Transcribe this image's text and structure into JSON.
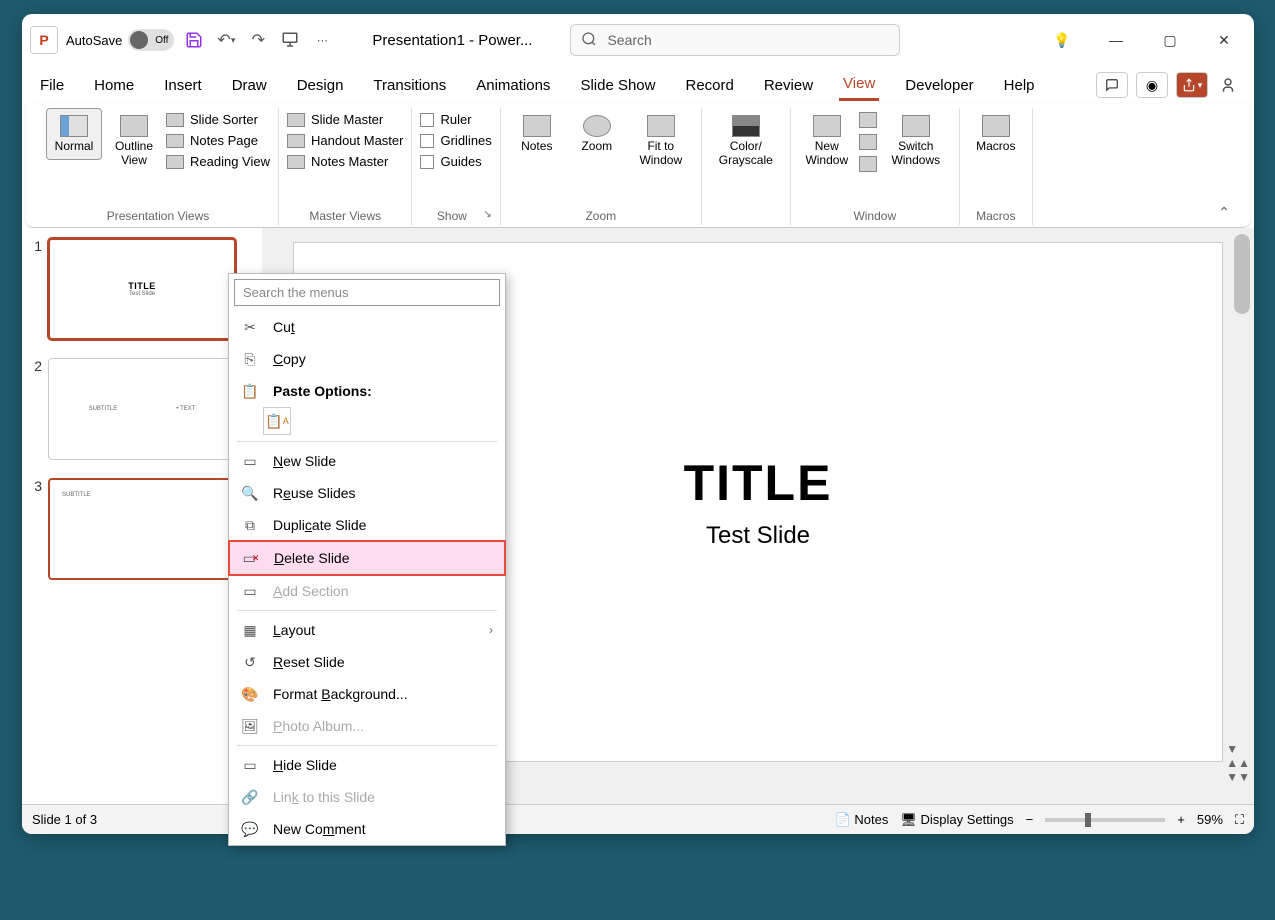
{
  "titlebar": {
    "app_letter": "P",
    "autosave_label": "AutoSave",
    "autosave_state": "Off",
    "document_title": "Presentation1  -  Power...",
    "search_placeholder": "Search"
  },
  "tabs": [
    "File",
    "Home",
    "Insert",
    "Draw",
    "Design",
    "Transitions",
    "Animations",
    "Slide Show",
    "Record",
    "Review",
    "View",
    "Developer",
    "Help"
  ],
  "active_tab": "View",
  "ribbon": {
    "groups": {
      "presentation_views": {
        "label": "Presentation Views",
        "normal": "Normal",
        "outline": "Outline View",
        "slide_sorter": "Slide Sorter",
        "notes_page": "Notes Page",
        "reading_view": "Reading View"
      },
      "master_views": {
        "label": "Master Views",
        "slide_master": "Slide Master",
        "handout_master": "Handout Master",
        "notes_master": "Notes Master"
      },
      "show": {
        "label": "Show",
        "ruler": "Ruler",
        "gridlines": "Gridlines",
        "guides": "Guides"
      },
      "notes_zoom": {
        "notes": "Notes",
        "zoom": "Zoom",
        "fit": "Fit to Window",
        "label": "Zoom"
      },
      "color": {
        "color": "Color/ Grayscale"
      },
      "window": {
        "label": "Window",
        "new_window": "New Window",
        "switch": "Switch Windows"
      },
      "macros": {
        "label": "Macros",
        "macros": "Macros"
      }
    }
  },
  "thumbnails": [
    {
      "num": "1",
      "title": "TITLE",
      "sub": "Test Slide",
      "selected": true
    },
    {
      "num": "2",
      "left": "SUBTITLE",
      "right": "• TEXT"
    },
    {
      "num": "3",
      "left": "SUBTITLE",
      "selected2": true
    }
  ],
  "slide": {
    "title": "TITLE",
    "sub": "Test Slide"
  },
  "context_menu": {
    "search_placeholder": "Search the menus",
    "cut": "Cut",
    "copy": "Copy",
    "paste_options": "Paste Options:",
    "new_slide": "New Slide",
    "reuse": "Reuse Slides",
    "duplicate": "Duplicate Slide",
    "delete": "Delete Slide",
    "add_section": "Add Section",
    "layout": "Layout",
    "reset": "Reset Slide",
    "format_bg": "Format Background...",
    "photo_album": "Photo Album...",
    "hide": "Hide Slide",
    "link": "Link to this Slide",
    "new_comment": "New Comment"
  },
  "statusbar": {
    "slide_info": "Slide 1 of 3",
    "notes": "Notes",
    "display": "Display Settings",
    "zoom": "59%"
  }
}
